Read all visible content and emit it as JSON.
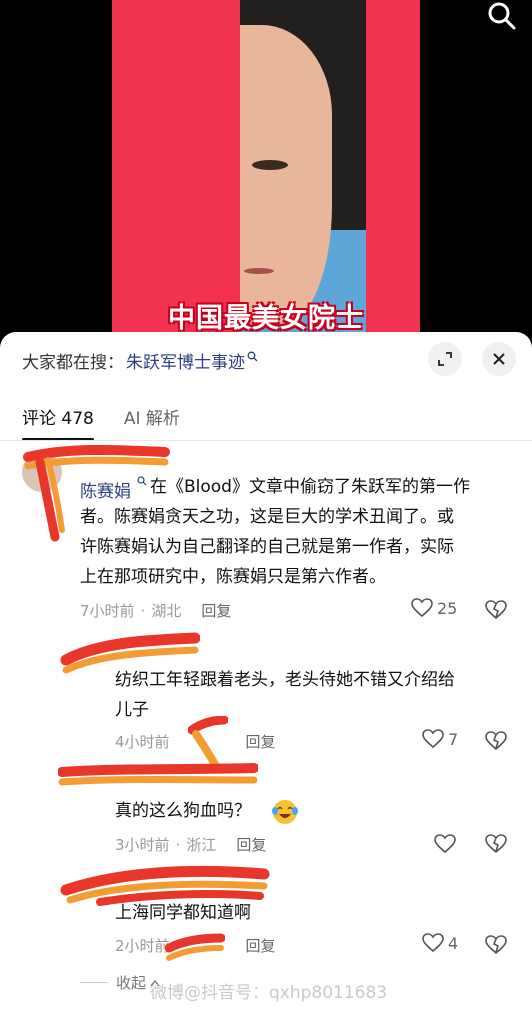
{
  "video": {
    "caption": "中国最美女院士"
  },
  "search_bar": {
    "prefix": "大家都在搜：",
    "term": "朱跃军博士事迹"
  },
  "tabs": [
    {
      "label": "评论 478"
    },
    {
      "label": "AI 解析"
    }
  ],
  "comments": [
    {
      "author": "陈赛娟",
      "text": "在《Blood》文章中偷窃了朱跃军的第一作者。陈赛娟贪天之功，这是巨大的学术丑闻了。或许陈赛娟认为自己翻译的自己就是第一作者，实际上在那项研究中，陈赛娟只是第六作者。",
      "text_lines": [
        "在《Blood》文章中偷窃了朱跃军的第一作",
        "者。陈赛娟贪天之功，这是巨大的学术丑闻了。或",
        "许陈赛娟认为自己翻译的自己就是第一作者，实际",
        "上在那项研究中，陈赛娟只是第六作者。"
      ],
      "time": "7小时前",
      "location": "湖北",
      "reply": "回复",
      "likes": "25"
    },
    {
      "text_lines": [
        "纺织工年轻跟着老头，老头待她不错又介绍给",
        "儿子"
      ],
      "time": "4小时前",
      "reply": "回复",
      "likes": "7"
    },
    {
      "text": "真的这么狗血吗？",
      "time": "3小时前",
      "location": "浙江",
      "reply": "回复",
      "likes": ""
    },
    {
      "text": "上海同学都知道啊",
      "time": "2小时前",
      "reply": "回复",
      "likes": "4"
    }
  ],
  "collapse_label": "收起",
  "watermark": "微博@抖音号：qxhp8011683",
  "icons": {
    "search": "search-icon",
    "expand": "expand-icon",
    "close": "close-icon",
    "heart": "heart-icon",
    "dislike": "broken-heart-icon",
    "emoji": "crying-laugh-emoji"
  },
  "colors": {
    "link_blue": "#2a3f86",
    "red_band": "#f2334f",
    "scribble_red": "#e8362b",
    "scribble_orange": "#f39c34"
  }
}
